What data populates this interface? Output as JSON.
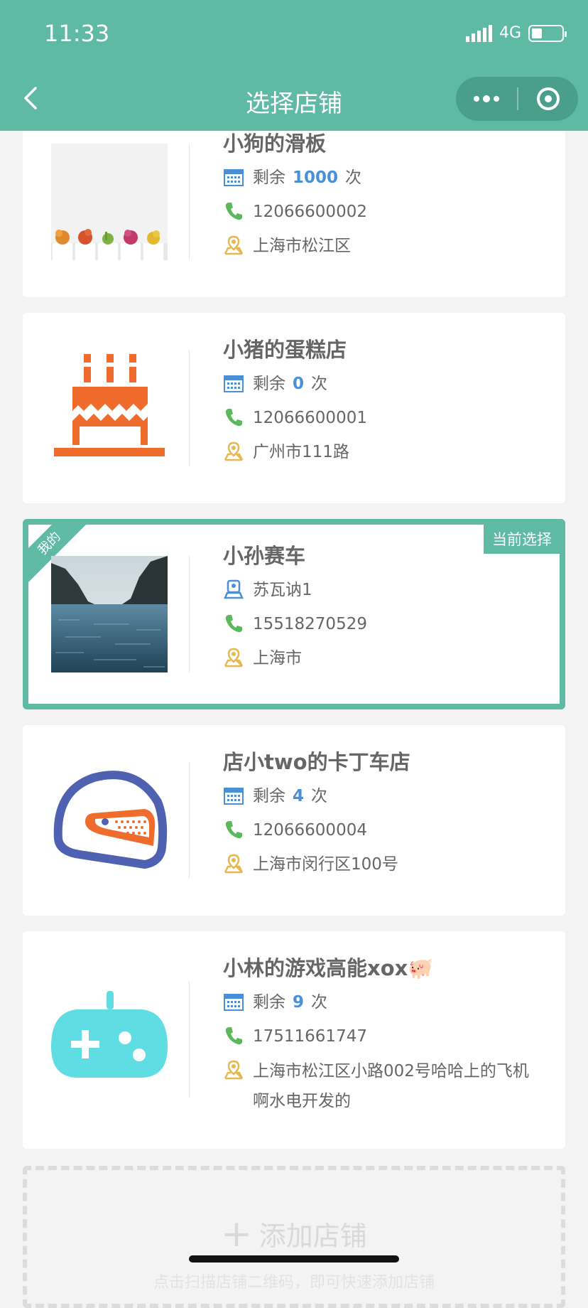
{
  "status_bar": {
    "time": "11:33",
    "network": "4G"
  },
  "nav": {
    "title": "选择店铺"
  },
  "stores": [
    {
      "name": "小狗的滑板",
      "count_prefix": "剩余",
      "count": "1000",
      "count_suffix": "次",
      "phone": "12066600002",
      "address": "上海市松江区",
      "image": "flower-pots"
    },
    {
      "name": "小猪的蛋糕店",
      "count_prefix": "剩余",
      "count": "0",
      "count_suffix": "次",
      "phone": "12066600001",
      "address": "广州市111路",
      "image": "cake-icon"
    },
    {
      "name": "小孙赛车",
      "owner": "苏瓦讷1",
      "phone": "15518270529",
      "address": "上海市",
      "mine_tag": "我的",
      "selected_tag": "当前选择",
      "image": "river-photo"
    },
    {
      "name": "店小two的卡丁车店",
      "count_prefix": "剩余",
      "count": "4",
      "count_suffix": "次",
      "phone": "12066600004",
      "address": "上海市闵行区100号",
      "image": "helmet-icon"
    },
    {
      "name": "小林的游戏高能xox🐖",
      "count_prefix": "剩余",
      "count": "9",
      "count_suffix": "次",
      "phone": "17511661747",
      "address": "上海市松江区小路002号哈哈上的飞机啊水电开发的",
      "image": "gamepad-icon"
    }
  ],
  "add_store": {
    "label": "添加店铺",
    "hint": "点击扫描店铺二维码，即可快速添加店铺"
  },
  "colors": {
    "primary": "#5eb9a5",
    "count": "#4a90d9",
    "phone_icon": "#5cb85c",
    "calendar_icon": "#4a90d9",
    "location_icon": "#e6b84f"
  }
}
